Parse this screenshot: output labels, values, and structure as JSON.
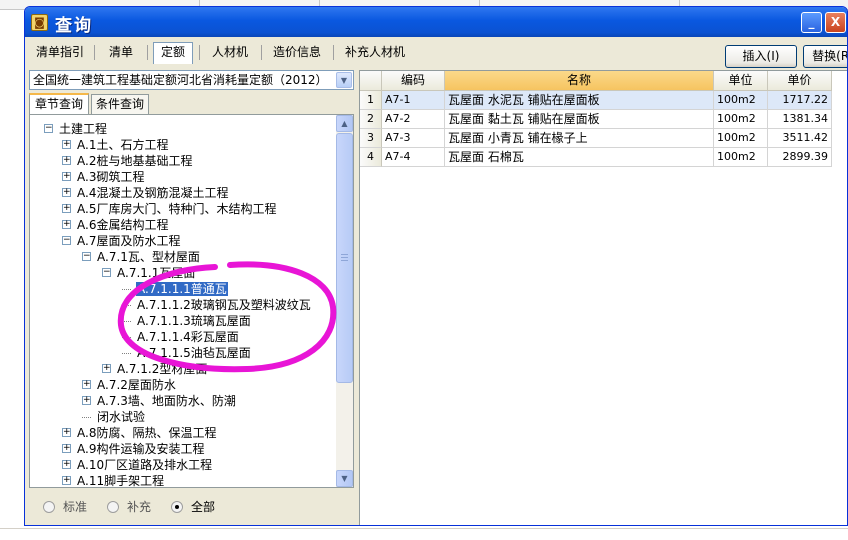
{
  "window": {
    "title": "查询",
    "app_icon_glyph": "◙"
  },
  "title_buttons": [
    {
      "name": "minimize-button",
      "glyph": "_"
    },
    {
      "name": "close-button",
      "glyph": "X"
    }
  ],
  "tabs": [
    {
      "label": "清单指引",
      "active": false
    },
    {
      "label": "清单",
      "active": false
    },
    {
      "label": "定额",
      "active": true
    },
    {
      "label": "人材机",
      "active": false
    },
    {
      "label": "造价信息",
      "active": false
    },
    {
      "label": "补充人材机",
      "active": false
    }
  ],
  "toolbar": {
    "insert_label": "插入(I)",
    "replace_label": "替换(R)"
  },
  "quota_combo": {
    "value": "全国统一建筑工程基础定额河北省消耗量定额（2012）",
    "arrow_glyph": "▼"
  },
  "subtabs": [
    {
      "label": "章节查询",
      "active": true
    },
    {
      "label": "条件查询",
      "active": false
    }
  ],
  "tree": [
    {
      "label": "土建工程",
      "level": 0,
      "state": "expanded"
    },
    {
      "label": "A.1土、石方工程",
      "level": 1,
      "state": "collapsed"
    },
    {
      "label": "A.2桩与地基基础工程",
      "level": 1,
      "state": "collapsed"
    },
    {
      "label": "A.3砌筑工程",
      "level": 1,
      "state": "collapsed"
    },
    {
      "label": "A.4混凝土及钢筋混凝土工程",
      "level": 1,
      "state": "collapsed"
    },
    {
      "label": "A.5厂库房大门、特种门、木结构工程",
      "level": 1,
      "state": "collapsed"
    },
    {
      "label": "A.6金属结构工程",
      "level": 1,
      "state": "collapsed"
    },
    {
      "label": "A.7屋面及防水工程",
      "level": 1,
      "state": "expanded"
    },
    {
      "label": "A.7.1瓦、型材屋面",
      "level": 2,
      "state": "expanded"
    },
    {
      "label": "A.7.1.1瓦屋面",
      "level": 3,
      "state": "expanded"
    },
    {
      "label": "A.7.1.1.1普通瓦",
      "level": 4,
      "state": "leaf",
      "selected": true
    },
    {
      "label": "A.7.1.1.2玻璃钢瓦及塑料波纹瓦",
      "level": 4,
      "state": "leaf"
    },
    {
      "label": "A.7.1.1.3琉璃瓦屋面",
      "level": 4,
      "state": "leaf"
    },
    {
      "label": "A.7.1.1.4彩瓦屋面",
      "level": 4,
      "state": "leaf"
    },
    {
      "label": "A.7.1.1.5油毡瓦屋面",
      "level": 4,
      "state": "leaf"
    },
    {
      "label": "A.7.1.2型材屋面",
      "level": 3,
      "state": "collapsed"
    },
    {
      "label": "A.7.2屋面防水",
      "level": 2,
      "state": "collapsed"
    },
    {
      "label": "A.7.3墙、地面防水、防潮",
      "level": 2,
      "state": "collapsed"
    },
    {
      "label": "闭水试验",
      "level": 2,
      "state": "leaf"
    },
    {
      "label": "A.8防腐、隔热、保温工程",
      "level": 1,
      "state": "collapsed"
    },
    {
      "label": "A.9构件运输及安装工程",
      "level": 1,
      "state": "collapsed"
    },
    {
      "label": "A.10厂区道路及排水工程",
      "level": 1,
      "state": "collapsed"
    },
    {
      "label": "A.11脚手架工程",
      "level": 1,
      "state": "collapsed"
    }
  ],
  "radios": [
    {
      "label": "标准",
      "checked": false
    },
    {
      "label": "补充",
      "checked": false
    },
    {
      "label": "全部",
      "checked": true
    }
  ],
  "grid": {
    "columns": [
      "编码",
      "名称",
      "单位",
      "单价"
    ],
    "rows": [
      {
        "num": "1",
        "code": "A7-1",
        "name": "瓦屋面 水泥瓦 铺贴在屋面板",
        "unit": "100m2",
        "price": "1717.22",
        "selected": true
      },
      {
        "num": "2",
        "code": "A7-2",
        "name": "瓦屋面 黏土瓦 铺贴在屋面板",
        "unit": "100m2",
        "price": "1381.34"
      },
      {
        "num": "3",
        "code": "A7-3",
        "name": "瓦屋面 小青瓦 铺在椽子上",
        "unit": "100m2",
        "price": "3511.42"
      },
      {
        "num": "4",
        "code": "A7-4",
        "name": "瓦屋面 石棉瓦",
        "unit": "100m2",
        "price": "2899.39"
      }
    ]
  },
  "colors": {
    "titlebar": "#0b52d2",
    "selection": "#316ac5",
    "annotation": "#e815d6",
    "name_header": "#f6c460"
  }
}
